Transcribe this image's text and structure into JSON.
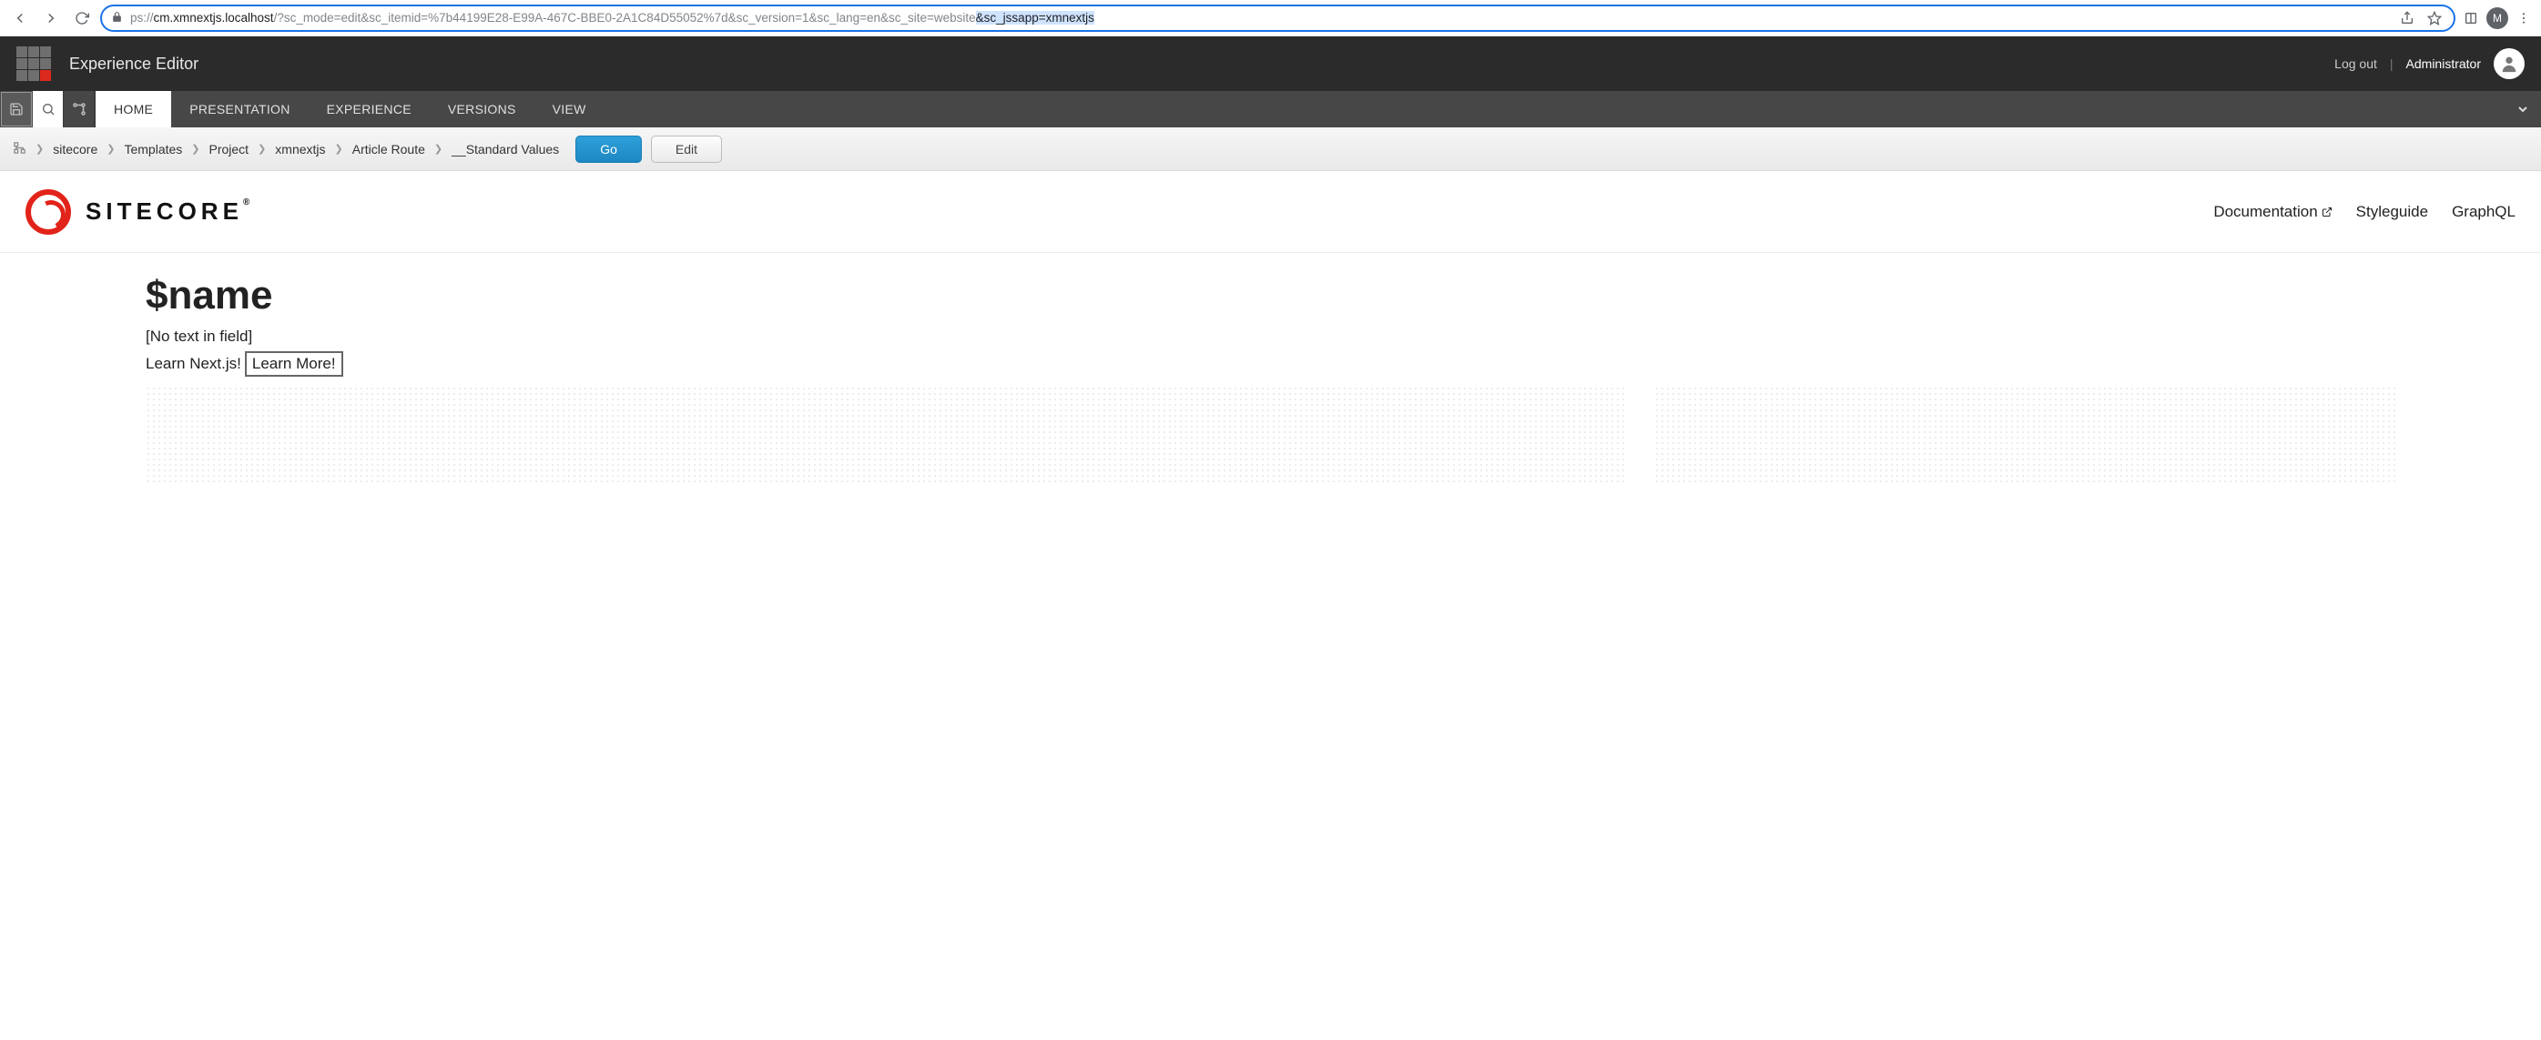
{
  "browser": {
    "url_dim_prefix": "ps://",
    "url_host": "cm.xmnextjs.localhost",
    "url_path": "/?sc_mode=edit&sc_itemid=%7b44199E28-E99A-467C-BBE0-2A1C84D55052%7d&sc_version=1&sc_lang=en&sc_site=website",
    "url_highlight": "&sc_jssapp=xmnextjs",
    "profile_initial": "M"
  },
  "header": {
    "app_title": "Experience Editor",
    "logout": "Log out",
    "user": "Administrator"
  },
  "ribbon": {
    "tabs": [
      "HOME",
      "PRESENTATION",
      "EXPERIENCE",
      "VERSIONS",
      "VIEW"
    ],
    "active_index": 0
  },
  "breadcrumb": {
    "items": [
      "sitecore",
      "Templates",
      "Project",
      "xmnextjs",
      "Article Route",
      "__Standard Values"
    ],
    "go": "Go",
    "edit": "Edit"
  },
  "site": {
    "brand": "SITECORE",
    "nav": {
      "docs": "Documentation",
      "styleguide": "Styleguide",
      "graphql": "GraphQL"
    }
  },
  "page": {
    "title": "$name",
    "empty_field": "[No text in field]",
    "learn_text": "Learn Next.js!",
    "learn_more": "Learn More!"
  }
}
